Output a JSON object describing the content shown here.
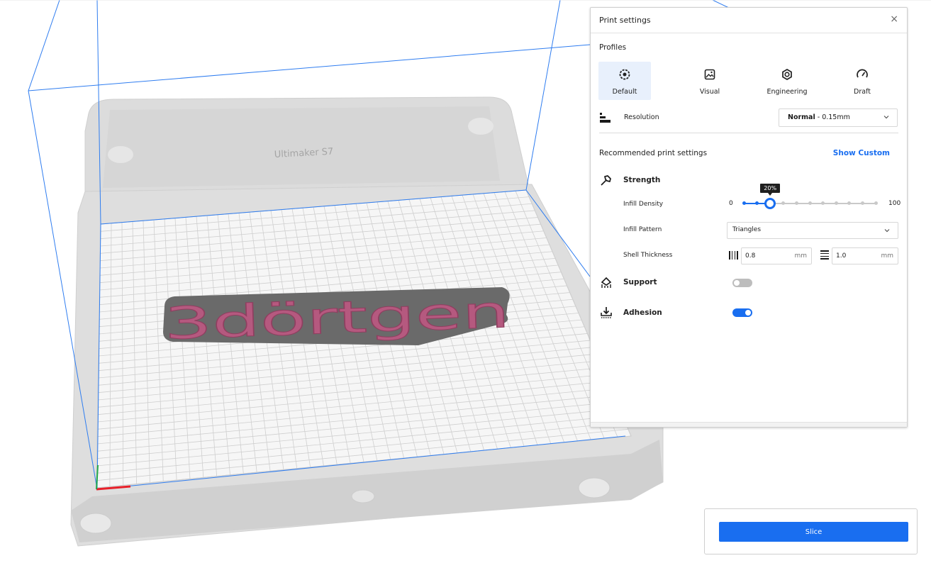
{
  "viewport": {
    "printer_label": "Ultimaker S7",
    "model_text": "3dörtgen"
  },
  "panel": {
    "title": "Print settings",
    "close_glyph": "×",
    "profiles_label": "Profiles",
    "profiles": [
      {
        "label": "Default",
        "icon": "default-profile-icon",
        "active": true
      },
      {
        "label": "Visual",
        "icon": "image-icon",
        "active": false
      },
      {
        "label": "Engineering",
        "icon": "engineering-icon",
        "active": false
      },
      {
        "label": "Draft",
        "icon": "speedometer-icon",
        "active": false
      }
    ],
    "resolution": {
      "label": "Resolution",
      "value_bold": "Normal",
      "value_rest": " - 0.15mm"
    },
    "recommended_label": "Recommended print settings",
    "show_custom_label": "Show Custom",
    "strength": {
      "label": "Strength",
      "infill_density_label": "Infill Density",
      "infill_min": "0",
      "infill_max": "100",
      "infill_value": 20,
      "infill_value_label": "20%",
      "infill_pattern_label": "Infill Pattern",
      "infill_pattern_value": "Triangles",
      "shell_thickness_label": "Shell Thickness",
      "wall_value": "0.8",
      "top_bottom_value": "1.0",
      "unit": "mm"
    },
    "support": {
      "label": "Support",
      "enabled": false
    },
    "adhesion": {
      "label": "Adhesion",
      "enabled": true
    }
  },
  "slice": {
    "label": "Slice"
  },
  "colors": {
    "accent": "#196ef0",
    "model": "#b5597f",
    "build_volume": "#2f7df0"
  }
}
